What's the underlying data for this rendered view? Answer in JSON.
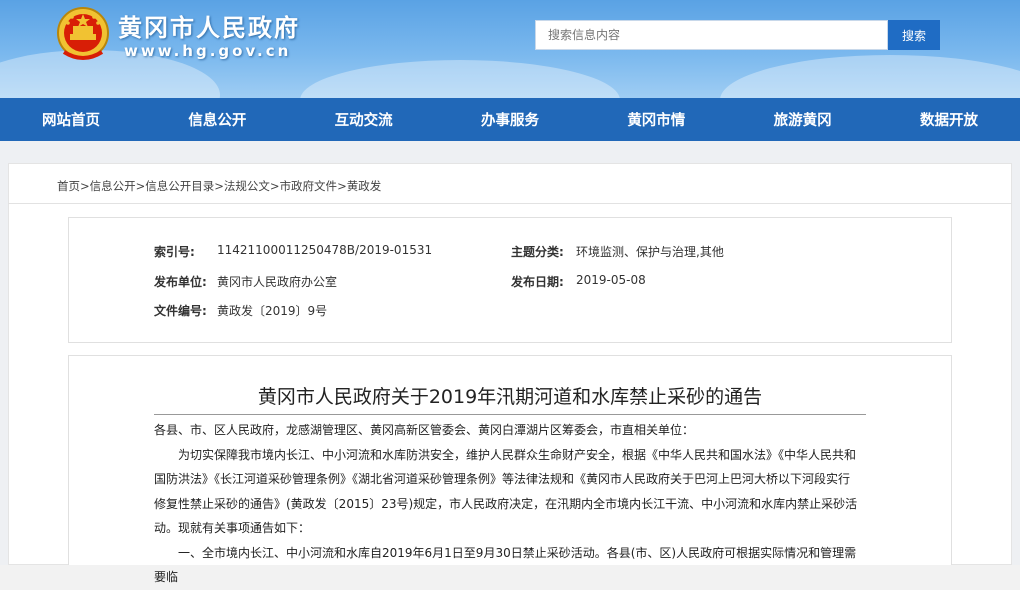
{
  "header": {
    "site_title": "黄冈市人民政府",
    "site_url": "www.hg.gov.cn",
    "search_placeholder": "搜索信息内容",
    "search_button": "搜索"
  },
  "nav": {
    "items": [
      "网站首页",
      "信息公开",
      "互动交流",
      "办事服务",
      "黄冈市情",
      "旅游黄冈",
      "数据开放"
    ]
  },
  "breadcrumb": [
    "首页",
    "信息公开",
    "信息公开目录",
    "法规公文",
    "市政府文件",
    "黄政发"
  ],
  "meta": {
    "index_label": "索引号:",
    "index_value": "11421100011250478B/2019-01531",
    "category_label": "主题分类:",
    "category_value": "环境监测、保护与治理,其他",
    "publisher_label": "发布单位:",
    "publisher_value": "黄冈市人民政府办公室",
    "date_label": "发布日期:",
    "date_value": "2019-05-08",
    "docno_label": "文件编号:",
    "docno_value": "黄政发〔2019〕9号"
  },
  "article": {
    "title": "黄冈市人民政府关于2019年汛期河道和水库禁止采砂的通告",
    "salutation": "各县、市、区人民政府，龙感湖管理区、黄冈高新区管委会、黄冈白潭湖片区筹委会，市直相关单位：",
    "para1_line1": "为切实保障我市境内长江、中小河流和水库防洪安全，维护人民群众生命财产安全，根据《中华人民共和国水法》《中华人民共和",
    "para1_line2": "国防洪法》《长江河道采砂管理条例》《湖北省河道采砂管理条例》等法律法规和《黄冈市人民政府关于巴河上巴河大桥以下河段实行",
    "para1_line3": "修复性禁止采砂的通告》(黄政发〔2015〕23号)规定，市人民政府决定，在汛期内全市境内长江干流、中小河流和水库内禁止采砂活",
    "para1_line4": "动。现就有关事项通告如下：",
    "para2": "一、全市境内长江、中小河流和水库自2019年6月1日至9月30日禁止采砂活动。各县(市、区)人民政府可根据实际情况和管理需要临"
  }
}
